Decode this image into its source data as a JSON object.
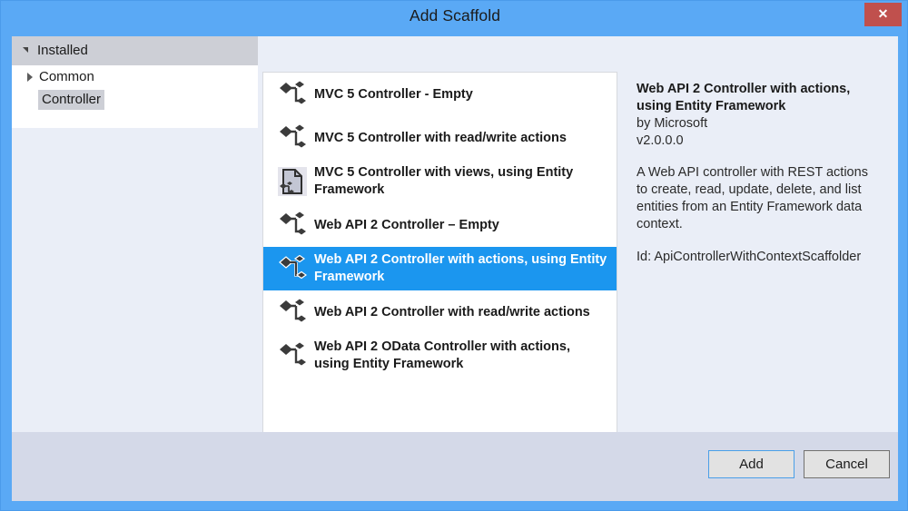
{
  "window": {
    "title": "Add Scaffold",
    "close_label": "✕",
    "accent_blue": "#5aa9f5",
    "selection_blue": "#1b96ef",
    "close_red": "#c0504d",
    "content_bg": "#eaeef7",
    "footer_bg": "#d4d9e8"
  },
  "sidebar": {
    "header": "Installed",
    "items": [
      {
        "label": "Common",
        "expandable": true,
        "selected": false
      },
      {
        "label": "Controller",
        "expandable": false,
        "selected": true
      }
    ]
  },
  "list": {
    "items": [
      {
        "label": "MVC 5 Controller - Empty",
        "icon": "controller-node-icon",
        "selected": false
      },
      {
        "label": "MVC 5 Controller with read/write actions",
        "icon": "controller-node-icon",
        "selected": false
      },
      {
        "label": "MVC 5 Controller with views, using Entity Framework",
        "icon": "controller-page-icon",
        "selected": false
      },
      {
        "label": "Web API 2 Controller – Empty",
        "icon": "controller-node-icon",
        "selected": false
      },
      {
        "label": "Web API 2 Controller with actions, using Entity Framework",
        "icon": "controller-node-icon",
        "selected": true
      },
      {
        "label": "Web API 2 Controller with read/write actions",
        "icon": "controller-node-icon",
        "selected": false
      },
      {
        "label": "Web API 2 OData Controller with actions, using Entity Framework",
        "icon": "controller-node-icon",
        "selected": false
      }
    ]
  },
  "detail": {
    "title": "Web API 2 Controller with actions, using Entity Framework",
    "author": "by Microsoft",
    "version": "v2.0.0.0",
    "description": "A Web API controller with REST actions to create, read, update, delete, and list entities from an Entity Framework data context.",
    "id": "Id: ApiControllerWithContextScaffolder"
  },
  "footer": {
    "add_label": "Add",
    "cancel_label": "Cancel"
  }
}
